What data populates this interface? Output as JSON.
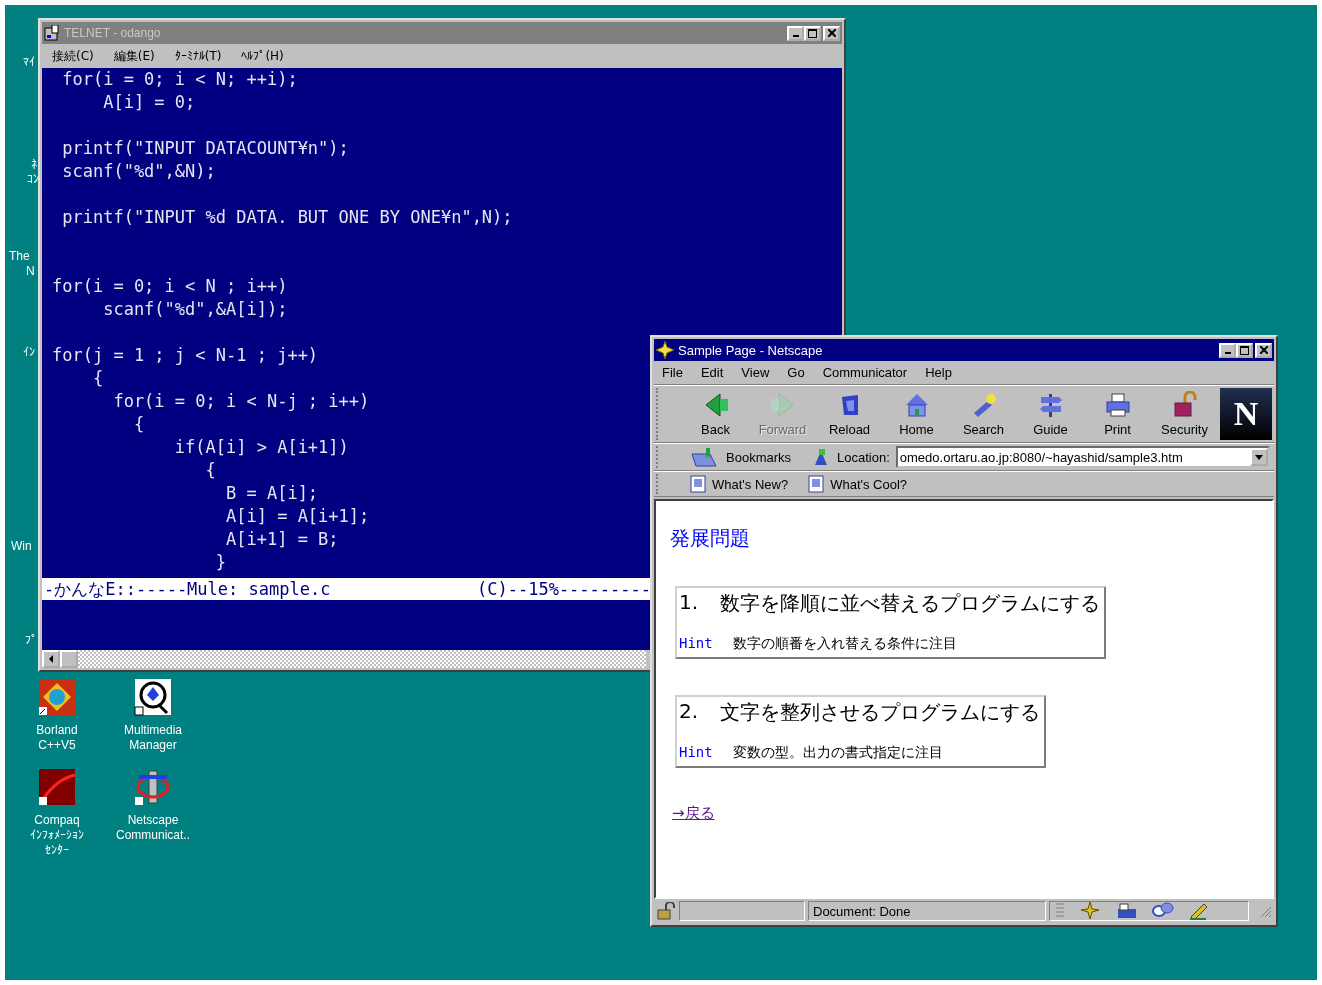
{
  "desktop": {
    "edge_labels": [
      "ﾏｲ",
      "ﾈ",
      "ｺﾝ",
      "The",
      "N",
      "ｲﾝ",
      "Win",
      "ﾌﾟ"
    ],
    "icons": [
      {
        "kind": "borland",
        "label": [
          "Borland",
          "C++V5"
        ]
      },
      {
        "kind": "multimedia",
        "label": [
          "Multimedia",
          "Manager"
        ]
      },
      {
        "kind": "compaq",
        "label": [
          "Compaq",
          "ｲﾝﾌｫﾒｰｼｮﾝ",
          "ｾﾝﾀｰ"
        ]
      },
      {
        "kind": "netscape",
        "label": [
          "Netscape",
          "Communicat.."
        ]
      }
    ]
  },
  "telnet": {
    "title": "TELNET - odango",
    "menu": [
      "接続(C)",
      "編集(E)",
      "ﾀｰﾐﾅﾙ(T)",
      "ﾍﾙﾌﾟ(H)"
    ],
    "code_blocks": [
      [
        " for(i = 0; i < N; ++i);",
        "     A[i] = 0;"
      ],
      [
        " printf(\"INPUT DATACOUNT¥n\");",
        " scanf(\"%d\",&N);"
      ],
      [
        " printf(\"INPUT %d DATA. BUT ONE BY ONE¥n\",N);"
      ],
      [
        "for(i = 0; i < N ; i++)",
        "     scanf(\"%d\",&A[i]);"
      ],
      [
        "for(j = 1 ; j < N-1 ; j++)",
        "    {",
        "      for(i = 0; i < N-j ; i++)",
        "        {",
        "            if(A[i] > A[i+1])",
        "               {",
        "                 B = A[i];",
        "                 A[i] = A[i+1];",
        "                 A[i+1] = B;",
        "                }"
      ]
    ],
    "mode_line": {
      "left": "-かんなE::-----Mule: sample.c",
      "right": "(C)--15%---------"
    }
  },
  "netscape": {
    "title": "Sample Page - Netscape",
    "menu": [
      "File",
      "Edit",
      "View",
      "Go",
      "Communicator",
      "Help"
    ],
    "toolbar": [
      {
        "kind": "back",
        "label": "Back",
        "disabled": false
      },
      {
        "kind": "forward",
        "label": "Forward",
        "disabled": true
      },
      {
        "kind": "reload",
        "label": "Reload",
        "disabled": false
      },
      {
        "kind": "home",
        "label": "Home",
        "disabled": false
      },
      {
        "kind": "search",
        "label": "Search",
        "disabled": false
      },
      {
        "kind": "guide",
        "label": "Guide",
        "disabled": false
      },
      {
        "kind": "print",
        "label": "Print",
        "disabled": false
      },
      {
        "kind": "security",
        "label": "Security",
        "disabled": false
      }
    ],
    "logo": "N",
    "bookmarks": "Bookmarks",
    "location_label": "Location:",
    "location_value": "omedo.ortaru.ao.jp:8080/~hayashid/sample3.htm",
    "personal": [
      "What's New?",
      "What's Cool?"
    ],
    "page": {
      "heading": "発展問題",
      "problems": [
        {
          "number": "1.",
          "text": "数字を降順に並べ替えるプログラムにする",
          "hint_label": "Hint",
          "hint": "数字の順番を入れ替える条件に注目"
        },
        {
          "number": "2.",
          "text": "文字を整列させるプログラムにする",
          "hint_label": "Hint",
          "hint": "変数の型。出力の書式指定に注目"
        }
      ],
      "back_link": "→戻る"
    },
    "status": "Document: Done"
  }
}
